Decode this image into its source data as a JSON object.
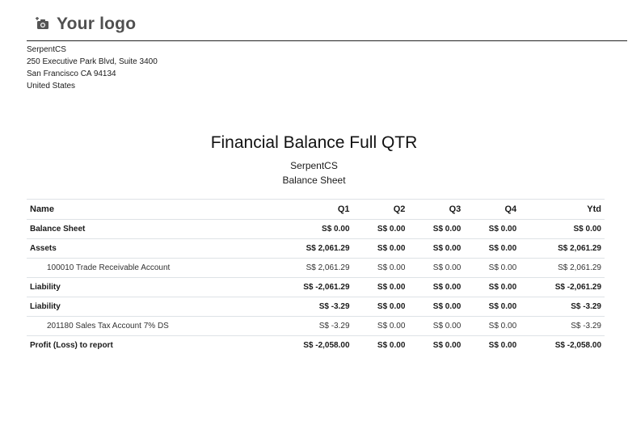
{
  "header": {
    "logo_text": "Your logo",
    "logo_icon": "camera-icon",
    "company": {
      "name": "SerpentCS",
      "street": "250 Executive Park Blvd, Suite 3400",
      "city": "San Francisco CA 94134",
      "country": "United States"
    }
  },
  "report": {
    "title": "Financial Balance Full QTR",
    "company": "SerpentCS",
    "subtitle": "Balance Sheet"
  },
  "table": {
    "columns": [
      "Name",
      "Q1",
      "Q2",
      "Q3",
      "Q4",
      "Ytd"
    ],
    "rows": [
      {
        "name": "Balance Sheet",
        "level": 0,
        "q1": "S$ 0.00",
        "q2": "S$ 0.00",
        "q3": "S$ 0.00",
        "q4": "S$ 0.00",
        "ytd": "S$ 0.00"
      },
      {
        "name": "Assets",
        "level": 0,
        "q1": "S$ 2,061.29",
        "q2": "S$ 0.00",
        "q3": "S$ 0.00",
        "q4": "S$ 0.00",
        "ytd": "S$ 2,061.29"
      },
      {
        "name": "100010 Trade Receivable Account",
        "level": 1,
        "q1": "S$ 2,061.29",
        "q2": "S$ 0.00",
        "q3": "S$ 0.00",
        "q4": "S$ 0.00",
        "ytd": "S$ 2,061.29"
      },
      {
        "name": "Liability",
        "level": 0,
        "q1": "S$ -2,061.29",
        "q2": "S$ 0.00",
        "q3": "S$ 0.00",
        "q4": "S$ 0.00",
        "ytd": "S$ -2,061.29"
      },
      {
        "name": "Liability",
        "level": 0,
        "q1": "S$ -3.29",
        "q2": "S$ 0.00",
        "q3": "S$ 0.00",
        "q4": "S$ 0.00",
        "ytd": "S$ -3.29"
      },
      {
        "name": "201180 Sales Tax Account 7% DS",
        "level": 1,
        "q1": "S$ -3.29",
        "q2": "S$ 0.00",
        "q3": "S$ 0.00",
        "q4": "S$ 0.00",
        "ytd": "S$ -3.29"
      },
      {
        "name": "Profit (Loss) to report",
        "level": 0,
        "q1": "S$ -2,058.00",
        "q2": "S$ 0.00",
        "q3": "S$ 0.00",
        "q4": "S$ 0.00",
        "ytd": "S$ -2,058.00"
      }
    ]
  },
  "colors": {
    "rule": "#222222",
    "row_border": "#dee2e6",
    "logo": "#505050"
  }
}
